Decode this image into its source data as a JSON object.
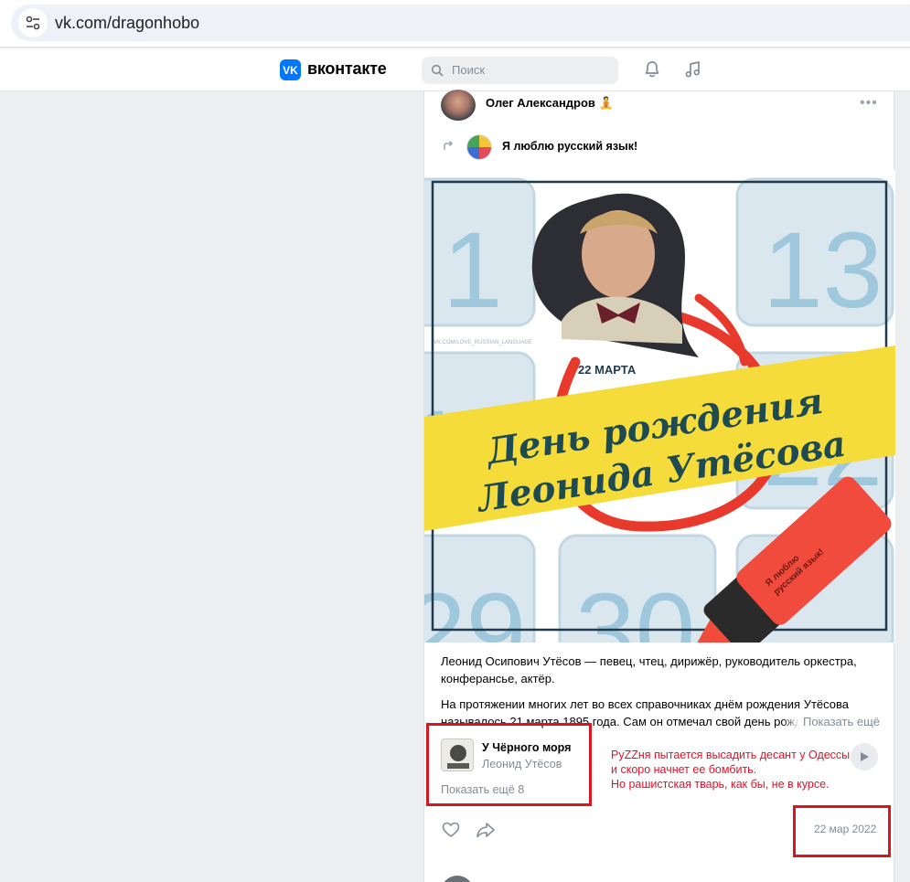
{
  "browser": {
    "url": "vk.com/dragonhobo",
    "icons": [
      "tune-icon"
    ]
  },
  "header": {
    "brand": "вконтакте",
    "logo_text": "VK",
    "search_placeholder": "Поиск",
    "icons": [
      "search-icon",
      "bell-icon",
      "music-note-icon"
    ],
    "brand_color": "#0077ff"
  },
  "post": {
    "author": "Олег Александров 🧘",
    "more_label": "•••",
    "repost_group": "Я люблю русский язык!",
    "image": {
      "watermark": "VK.COM/LOVE_RUSSIAN_LANGUAGE",
      "date_label": "22 МАРТА",
      "headline_line1": "День рождения",
      "headline_line2": "Леонида Утёсова",
      "calendar_numbers": [
        "1",
        "13",
        "10",
        "22",
        "29",
        "30"
      ],
      "marker_text_line1": "Я люблю",
      "marker_text_line2": "русский язык!"
    },
    "text_paragraph1": "Леонид Осипович Утёсов — певец, чтец, дирижёр, руководитель оркестра, конферансье, актёр.",
    "text_paragraph2": "На протяжении многих лет во всех справочниках днём рождения Утёсова называлось 21 марта 1895 года. Сам он отмечал свой день рождения",
    "show_more_label": "Показать ещё",
    "audio": {
      "title": "У Чёрного моря",
      "artist": "Леонид Утёсов",
      "show_more_label": "Показать ещё 8"
    },
    "annotation": "РуZZня пытается высадить десант у Одессы,\nи скоро начнет ее бомбить.\nНо рашистская тварь, как бы, не в курсе.",
    "date": "22 мар 2022",
    "accent_red": "#d9161e"
  }
}
